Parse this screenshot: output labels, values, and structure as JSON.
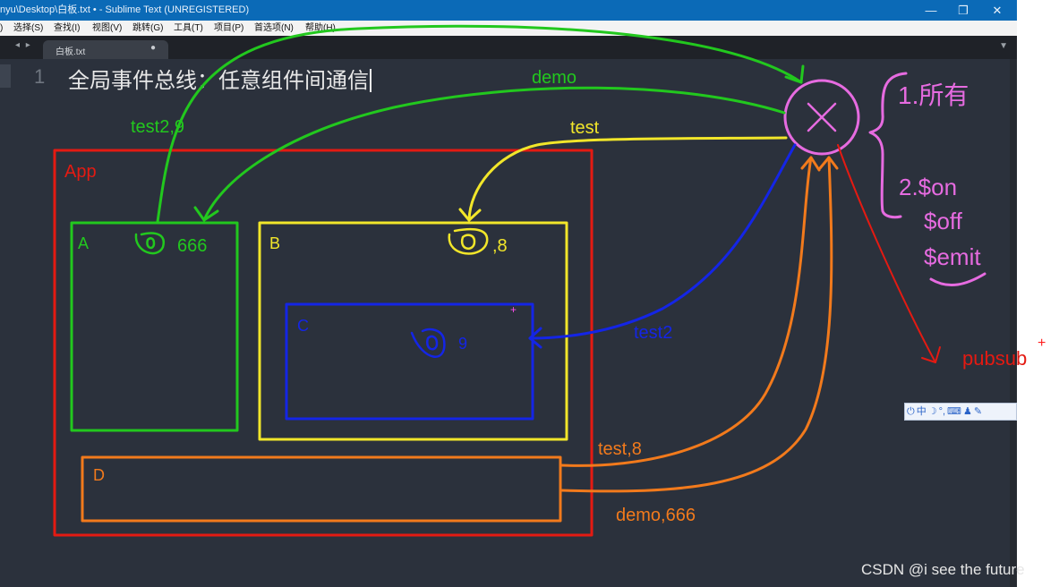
{
  "window": {
    "title": "nyu\\Desktop\\白板.txt • - Sublime Text (UNREGISTERED)",
    "controls": {
      "minimize": "—",
      "maximize": "❐",
      "close": "✕"
    }
  },
  "menu": {
    "edge": ")",
    "items": [
      "选择(S)",
      "查找(I)",
      "视图(V)",
      "跳转(G)",
      "工具(T)",
      "项目(P)",
      "首选项(N)",
      "帮助(H)"
    ]
  },
  "tabs": {
    "nav": "◂ ▸",
    "active": {
      "label": "白板.txt",
      "dirty": "●"
    },
    "menu": "▼"
  },
  "editor": {
    "line_number": "1",
    "line_text": "全局事件总线：任意组件间通信"
  },
  "whiteboard": {
    "boxes": {
      "app": "App",
      "a": "A",
      "b": "B",
      "c": "C",
      "d": "D"
    },
    "values": {
      "a": "666",
      "b": ",8",
      "c": "9"
    },
    "arrows": {
      "demo": "demo",
      "test": "test",
      "test2_9": "test2,9",
      "test2": "test2",
      "test_8": "test,8",
      "demo_666": "demo,666",
      "pubsub": "pubsub"
    },
    "bus": {
      "symbol": "X",
      "item1": "1.所有",
      "item2": "2.$on",
      "item3": "$off",
      "item4": "$emit"
    },
    "marks": {
      "plus_c": "+",
      "plus_pubsub": "+"
    },
    "colors": {
      "green": "#22c81e",
      "yellow": "#f2e62a",
      "blue": "#1425e6",
      "red": "#e41a12",
      "orange": "#f27a1c",
      "pink": "#e66be0"
    }
  },
  "ime": {
    "items": [
      "中",
      "☽",
      "°,",
      "⌨",
      "♟",
      "✎"
    ]
  },
  "watermark": "CSDN @i see the future"
}
